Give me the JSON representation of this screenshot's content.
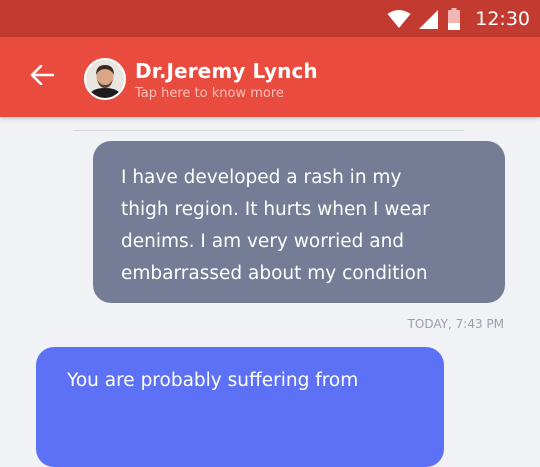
{
  "status_bar": {
    "time": "12:30",
    "icons": [
      "wifi-icon",
      "cellular-signal-icon",
      "battery-icon"
    ],
    "background": "#c23a30"
  },
  "app_bar": {
    "back_icon": "arrow-left-icon",
    "contact_name": "Dr.Jeremy Lynch",
    "subtitle": "Tap here to know more",
    "background": "#e94b3f"
  },
  "chat": {
    "background": "#f1f2f6",
    "messages": [
      {
        "direction": "outgoing",
        "lines": [
          "I have developed a rash in my",
          "thigh region.  It hurts when I wear",
          "denims. I am very worried and",
          "embarrassed about my condition"
        ],
        "timestamp": "TODAY, 7:43 PM",
        "color": "#757d96"
      },
      {
        "direction": "incoming",
        "lines": [
          "You are probably suffering from"
        ],
        "color": "#5d71f6"
      }
    ]
  }
}
